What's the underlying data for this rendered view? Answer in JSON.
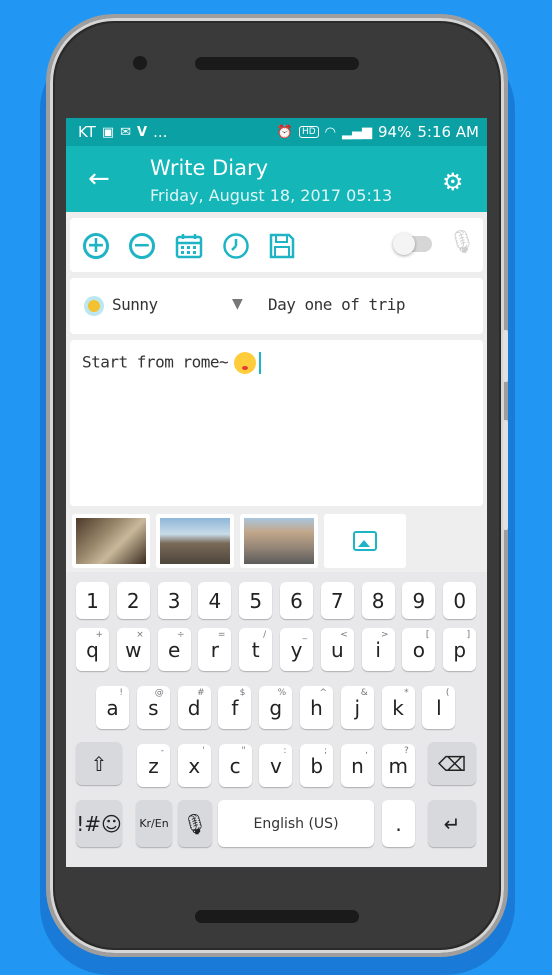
{
  "status_bar": {
    "carrier": "KT",
    "left_icons": [
      "image-icon",
      "gmail-icon",
      "vk-icon",
      "more-icon"
    ],
    "more": "...",
    "alarm_icon": "alarm-icon",
    "hd": "HD",
    "wifi_icon": "wifi-icon",
    "signal_icon": "signal-icon",
    "battery": "94%",
    "time": "5:16 AM"
  },
  "app_bar": {
    "title": "Write Diary",
    "subtitle": "Friday, August 18, 2017 05:13",
    "back_icon": "arrow-back-icon",
    "settings_icon": "gears-icon"
  },
  "toolbar": {
    "tools": [
      "add-icon",
      "remove-icon",
      "calendar-icon",
      "clock-icon",
      "save-icon"
    ],
    "toggle_on": false,
    "mic_icon": "mic-icon"
  },
  "entry": {
    "weather": "Sunny",
    "title": "Day one of trip",
    "content": "Start from rome~"
  },
  "photos": [
    "photo-1",
    "photo-2",
    "photo-3"
  ],
  "add_photo_icon": "image-add-icon",
  "keyboard": {
    "numbers": [
      "1",
      "2",
      "3",
      "4",
      "5",
      "6",
      "7",
      "8",
      "9",
      "0"
    ],
    "row1": [
      "q",
      "w",
      "e",
      "r",
      "t",
      "y",
      "u",
      "i",
      "o",
      "p"
    ],
    "row1_hints": [
      "+",
      "×",
      "÷",
      "=",
      "/",
      "_",
      "<",
      ">",
      "[",
      "]"
    ],
    "row2": [
      "a",
      "s",
      "d",
      "f",
      "g",
      "h",
      "j",
      "k",
      "l"
    ],
    "row2_hints": [
      "!",
      "@",
      "#",
      "$",
      "%",
      "^",
      "&",
      "*",
      "(",
      ")"
    ],
    "row3": [
      "z",
      "x",
      "c",
      "v",
      "b",
      "n",
      "m"
    ],
    "row3_hints": [
      "-",
      "'",
      "\"",
      ":",
      ";",
      ",",
      "?"
    ],
    "symbols_label": "!#☺",
    "lang_label": "Kr/En",
    "space_label": "English (US)",
    "period": "."
  },
  "colors": {
    "status_bar": "#0aa0a4",
    "app_bar": "#14b6b8",
    "accent": "#1eb4c6",
    "background": "#2196F3"
  }
}
